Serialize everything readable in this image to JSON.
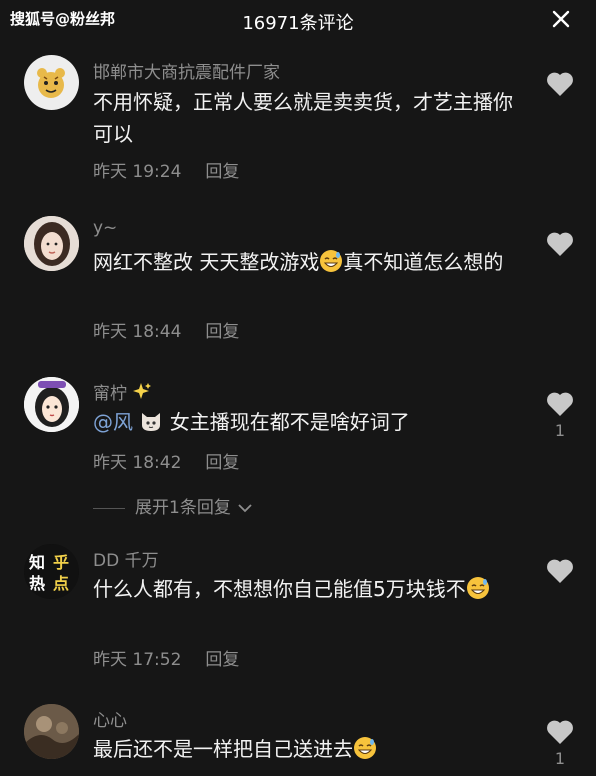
{
  "watermark": "搜狐号@粉丝邦",
  "header": {
    "title": "16971条评论"
  },
  "comments": [
    {
      "username": "邯郸市大商抗震配件厂家",
      "text": "不用怀疑，正常人要么就是卖卖货，才艺主播你可以",
      "time": "昨天 19:24",
      "reply": "回复"
    },
    {
      "username": "y~",
      "text_before": "网红不整改 天天整改游戏",
      "text_after": "真不知道怎么想的",
      "time": "昨天 18:44",
      "reply": "回复"
    },
    {
      "username": "甯柠",
      "mention": "@风",
      "text": "女主播现在都不是啥好词了",
      "time": "昨天 18:42",
      "reply": "回复",
      "likes": "1"
    },
    {
      "username": "DD 千万",
      "text": "什么人都有，不想想你自己能值5万块钱不",
      "time": "昨天 17:52",
      "reply": "回复"
    },
    {
      "username": "心心",
      "text": "最后还不是一样把自己送进去",
      "likes": "1"
    }
  ],
  "expand": {
    "label": "展开1条回复"
  },
  "avatar4_text": [
    "知",
    "乎",
    "热",
    "点"
  ],
  "icons": [
    "close-icon",
    "heart-icon",
    "sweat-smile-emoji",
    "cat-emoji",
    "chevron-down-icon",
    "sparkles-icon"
  ],
  "colors": {
    "background": "#161616",
    "muted": "#8e8e8e",
    "mention": "#7ea3d6",
    "heart": "#c8c8c8"
  }
}
